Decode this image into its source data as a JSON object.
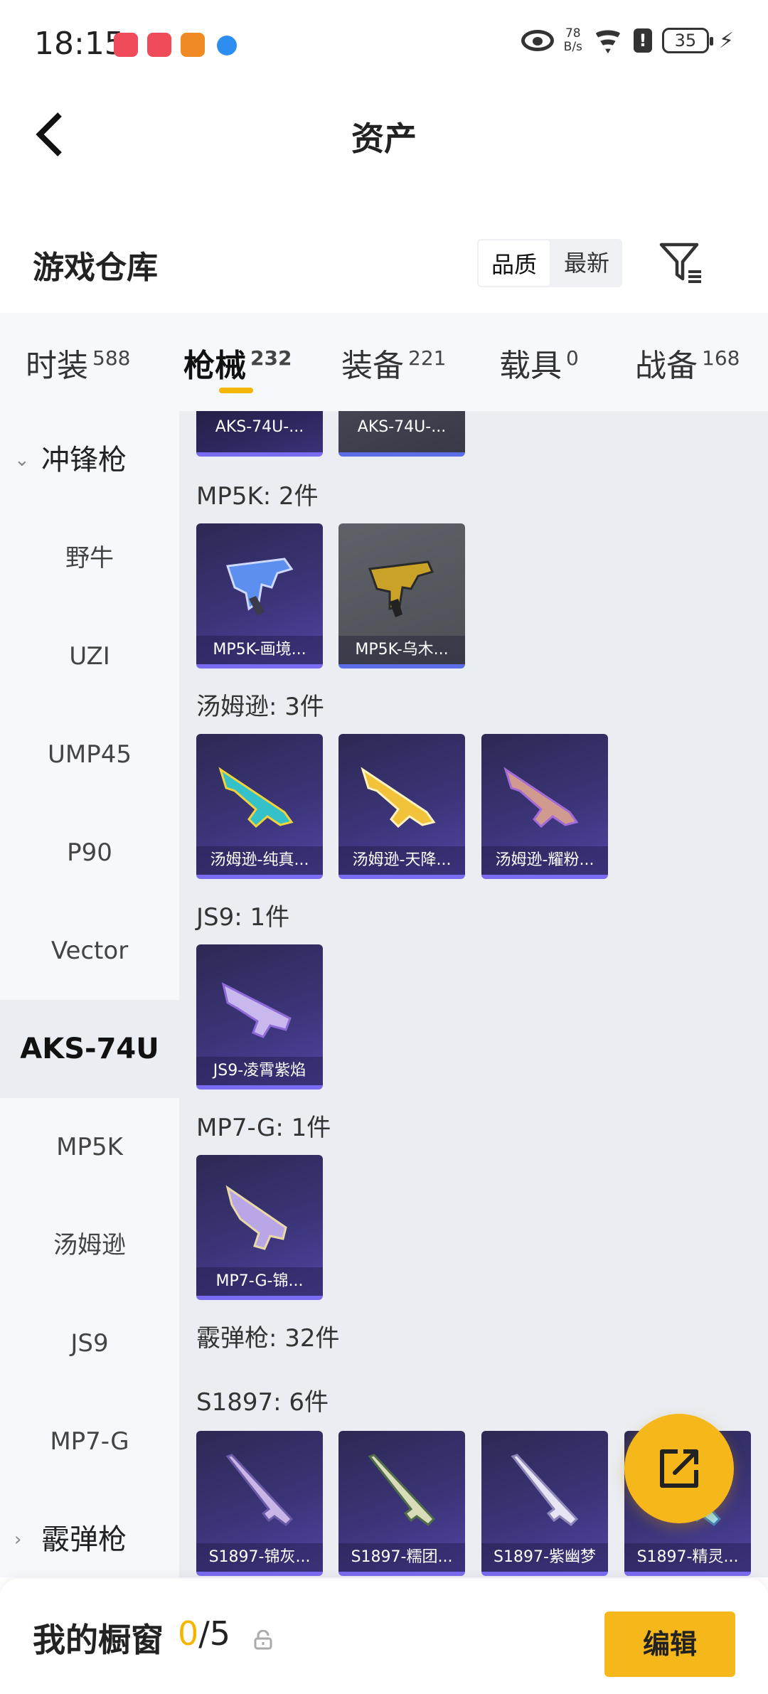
{
  "status_bar": {
    "time": "18:15",
    "net_speed_value": "78",
    "net_speed_unit": "B/s",
    "battery": "35",
    "app_icon_colors": [
      "#ef4b5b",
      "#ef4b5b",
      "#f08a24",
      "#2d8ef0"
    ]
  },
  "header": {
    "title": "资产",
    "back_icon": "chevron-left-icon"
  },
  "warehouse": {
    "title": "游戏仓库",
    "sort_options": [
      "品质",
      "最新"
    ],
    "active_sort": "品质",
    "filter_icon": "filter-icon"
  },
  "category_tabs": [
    {
      "label": "时装",
      "count": "588"
    },
    {
      "label": "枪械",
      "count": "232",
      "active": true
    },
    {
      "label": "装备",
      "count": "221"
    },
    {
      "label": "载具",
      "count": "0"
    },
    {
      "label": "战备",
      "count": "168"
    }
  ],
  "sidenav": [
    {
      "label": "冲锋枪",
      "type": "group",
      "expanded": true
    },
    {
      "label": "野牛"
    },
    {
      "label": "UZI"
    },
    {
      "label": "UMP45"
    },
    {
      "label": "P90"
    },
    {
      "label": "Vector"
    },
    {
      "label": "AKS-74U",
      "active": true
    },
    {
      "label": "MP5K"
    },
    {
      "label": "汤姆逊"
    },
    {
      "label": "JS9"
    },
    {
      "label": "MP7-G"
    },
    {
      "label": "霰弹枪",
      "type": "group",
      "expanded": false
    }
  ],
  "content": {
    "aks_partial": [
      {
        "name": "AKS-74U-...",
        "rarity": "purple"
      },
      {
        "name": "AKS-74U-...",
        "rarity": "gray"
      }
    ],
    "sections": [
      {
        "label": "MP5K: 2件",
        "items": [
          {
            "name": "MP5K-画境...",
            "rarity": "purple"
          },
          {
            "name": "MP5K-乌木...",
            "rarity": "gray"
          }
        ]
      },
      {
        "label": "汤姆逊: 3件",
        "items": [
          {
            "name": "汤姆逊-纯真...",
            "rarity": "purple"
          },
          {
            "name": "汤姆逊-天降...",
            "rarity": "purple"
          },
          {
            "name": "汤姆逊-耀粉...",
            "rarity": "purple"
          }
        ]
      },
      {
        "label": "JS9: 1件",
        "items": [
          {
            "name": "JS9-凌霄紫焰",
            "rarity": "purple"
          }
        ]
      },
      {
        "label": "MP7-G: 1件",
        "items": [
          {
            "name": "MP7-G-锦...",
            "rarity": "purple"
          }
        ]
      }
    ],
    "shotgun_header": "霰弹枪: 32件",
    "s1897": {
      "label": "S1897: 6件",
      "items": [
        {
          "name": "S1897-锦灰...",
          "rarity": "purple"
        },
        {
          "name": "S1897-糯团...",
          "rarity": "purple"
        },
        {
          "name": "S1897-紫幽梦",
          "rarity": "purple"
        },
        {
          "name": "S1897-精灵...",
          "rarity": "purple"
        }
      ]
    }
  },
  "fab": {
    "icon": "share-external-icon"
  },
  "bottom_bar": {
    "label": "我的橱窗",
    "used": "0",
    "total": "/5",
    "lock_icon": "lock-icon",
    "edit_label": "编辑"
  },
  "accent_color": "#f6b71b"
}
